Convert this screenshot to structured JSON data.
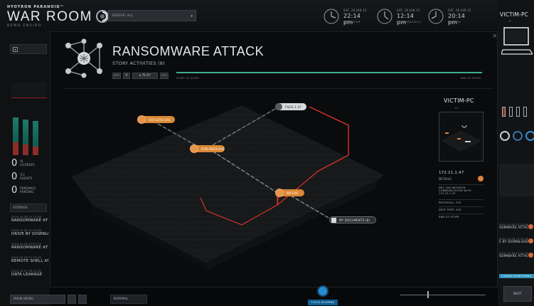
{
  "brand": {
    "small": "HYOTRON PARANOID™",
    "big": "WAR ROOM",
    "demo": "DEMO ENVIRO"
  },
  "server": {
    "value": "SERVER: ALL"
  },
  "clocks": [
    {
      "date": "SAT, 26 JUN 15",
      "time": "22:14 pm",
      "city": "JERUSALEM"
    },
    {
      "date": "SAT, 26 JUN 15",
      "time": "12:14 pm",
      "city": "SAN FRANCISCO"
    },
    {
      "date": "SAT, 26 JUN 15",
      "time": "20:14 pm",
      "city": "LONDON"
    }
  ],
  "panel": {
    "title": "RANSOMWARE ATTACK",
    "subtitle": "STORY ACTIVITIES (8)",
    "controls": {
      "rewind": "<<",
      "pause": "II",
      "play": "▸ PLAY",
      "forward": ">>"
    },
    "timeline": {
      "start": "START OF STORY",
      "end": "END OF STORY"
    },
    "close": "×"
  },
  "graph": {
    "nodes": [
      {
        "label": "OUTLOOK.EXE",
        "kind": "process"
      },
      {
        "label": "EXPLORER.EXE",
        "kind": "process"
      },
      {
        "label": "FILES 1.47",
        "kind": "file"
      },
      {
        "label": "RM.EXE",
        "kind": "process"
      },
      {
        "label": "MY DOCUMENTS (8)",
        "kind": "file"
      }
    ]
  },
  "victim": {
    "title": "VICTIM-PC",
    "sub": "PC",
    "ip": "172.21.1.47",
    "details_label": "DETAILS",
    "info": [
      "DEC 25K INITIATED COMMUNICATION WITH 172.21.1.47",
      "PROTOCOL: TCP",
      "DEST PORT: 443",
      "END OF STORY"
    ]
  },
  "left": {
    "stats": [
      {
        "num": "0",
        "label": "/8 LICENSES"
      },
      {
        "num": "0",
        "label": "/12 AGENTS"
      },
      {
        "num": "0",
        "label": "PENDINGS PENDING"
      }
    ],
    "stories_select": "STORIES",
    "stories": [
      {
        "date": "2014-10-28 21:13:46",
        "name": "RANSOMWARE ATT."
      },
      {
        "date": "2014-10-28 21:13:46",
        "name": "DRIVE BY DOWNLOI"
      },
      {
        "date": "2014-10-28 21:13:13",
        "name": "RANSOMWARE ATT."
      },
      {
        "date": "2014-10-28 21:13:19",
        "name": "REMOTE SHELL ATI"
      },
      {
        "date": "2014-10-27 09:22:44",
        "name": "DATA LEAKAGE"
      }
    ],
    "bar_values": [
      0.78,
      0.74,
      0.71
    ],
    "bar_red": [
      0.27,
      0.22,
      0.18
    ],
    "main_menu": "MAIN MENU"
  },
  "right": {
    "title": "VICTIM-PC",
    "sub": "PC",
    "stories": [
      {
        "date": "2014-10-28 21:13:46",
        "name": "SOMWARE ATTACK"
      },
      {
        "date": "2014-10-28 21:13:46",
        "name": "E BY DOWNLOAD"
      },
      {
        "date": "2014-10-28 21:13:13",
        "name": "SOMWARE ATTACK"
      }
    ],
    "monitor": "CHANGE MONITORING",
    "next": "NEXT"
  },
  "bottom": {
    "view_select": "NORMAL",
    "camera_label": "FOCUS ZOOMING"
  },
  "colors": {
    "accent": "#e0823a",
    "alert": "#d8342a",
    "ok": "#3fae8e",
    "info": "#2a8ad0"
  }
}
